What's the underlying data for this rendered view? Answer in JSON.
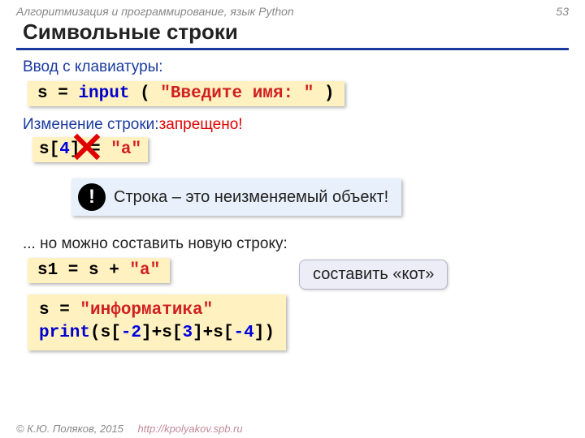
{
  "header": {
    "subject": "Алгоритмизация и программирование, язык Python",
    "page": "53"
  },
  "title": "Символьные строки",
  "section1": {
    "label": "Ввод с клавиатуры:"
  },
  "code1": {
    "var": "s",
    "eq": "=",
    "func": "input",
    "lpar": "(",
    "prompt": "\"Введите имя: \"",
    "rpar": ")"
  },
  "section2": {
    "a": "Изменение строки:",
    "b": "запрещено!"
  },
  "code2": {
    "lhs": "s[",
    "idx": "4",
    "rhs": "] = ",
    "val": "\"a\""
  },
  "notice": {
    "mark": "!",
    "text": "Строка – это неизменяемый объект!"
  },
  "section3": "... но можно составить новую строку:",
  "code3": {
    "lhs": "s1 = s + ",
    "val": "\"a\""
  },
  "callout": "составить «кот»",
  "code4": {
    "l1a": "s = ",
    "l1b": "\"информатика\"",
    "l2a": "print",
    "l2b": "(s[",
    "l2c": "-2",
    "l2d": "]+s[",
    "l2e": "3",
    "l2f": "]+s[",
    "l2g": "-4",
    "l2h": "])"
  },
  "footer": {
    "copy": "© К.Ю. Поляков, 2015",
    "url": "http://kpolyakov.spb.ru"
  }
}
